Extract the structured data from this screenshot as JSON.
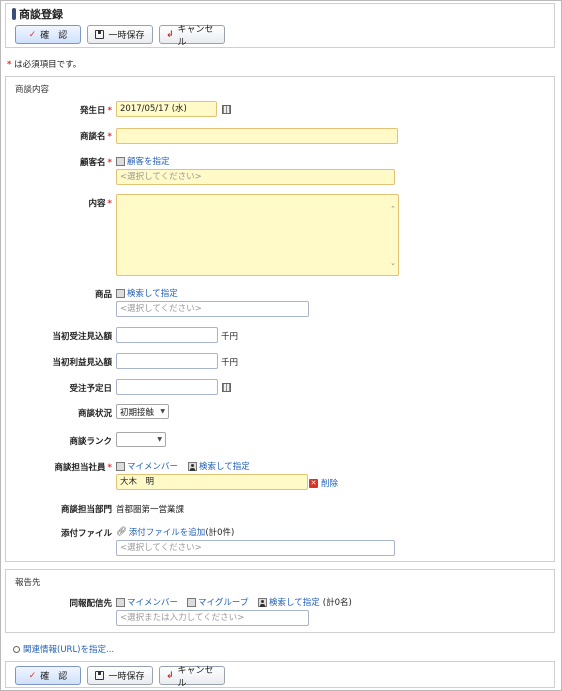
{
  "page": {
    "title": "商談登録",
    "required_note_star": "*",
    "required_note": " は必須項目です。"
  },
  "toolbar": {
    "confirm_label": "確　認",
    "save_label": "一時保存",
    "cancel_label": "キャンセル"
  },
  "form": {
    "section_title": "商談内容",
    "required_star": "*",
    "occurrence_date": {
      "label": "発生日",
      "value": "2017/05/17 (水)"
    },
    "deal_name": {
      "label": "商談名",
      "value": ""
    },
    "customer": {
      "label": "顧客名",
      "link": "顧客を指定",
      "placeholder": "<選択してください>"
    },
    "content": {
      "label": "内容",
      "value": ""
    },
    "product": {
      "label": "商品",
      "link": "検索して指定",
      "placeholder": "<選択してください>"
    },
    "initial_order_estimate": {
      "label": "当初受注見込額",
      "value": "",
      "unit": "千円"
    },
    "initial_profit_estimate": {
      "label": "当初利益見込額",
      "value": "",
      "unit": "千円"
    },
    "scheduled_order_date": {
      "label": "受注予定日",
      "value": ""
    },
    "deal_status": {
      "label": "商談状況",
      "value": "初期接触"
    },
    "deal_rank": {
      "label": "商談ランク",
      "value": ""
    },
    "staff": {
      "label": "商談担当社員",
      "link_my_members": "マイメンバー",
      "link_search": "検索して指定",
      "value": "大木　明",
      "delete_label": "削除",
      "delete_icon": "✕"
    },
    "department": {
      "label": "商談担当部門",
      "value": "首都圏第一営業課"
    },
    "attachment": {
      "label": "添付ファイル",
      "link": "添付ファイルを追加",
      "count": "(計0件)",
      "placeholder": "<選択してください>"
    }
  },
  "report": {
    "section_title": "報告先",
    "label": "同報配信先",
    "link_my_members": "マイメンバー",
    "link_my_groups": "マイグループ",
    "link_search": "検索して指定",
    "count": "(計0名)",
    "placeholder": "<選択または入力してください>"
  },
  "related_link": "関連情報(URL)を指定..."
}
